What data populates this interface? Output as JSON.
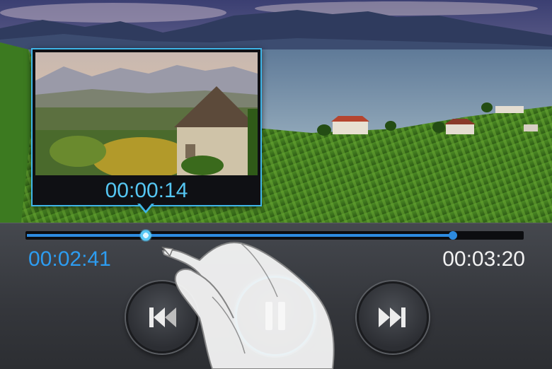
{
  "player": {
    "preview_time": "00:00:14",
    "current_time": "00:02:41",
    "total_time": "00:03:20",
    "buffered_fraction": 0.86,
    "thumb_fraction": 0.24
  },
  "controls": {
    "prev_icon": "skip-previous-icon",
    "pause_icon": "pause-icon",
    "next_icon": "skip-next-icon"
  },
  "colors": {
    "accent": "#3fb6e8",
    "progress": "#2d8be0",
    "current_time": "#2d9cf0",
    "total_time": "#f2f2f2"
  }
}
